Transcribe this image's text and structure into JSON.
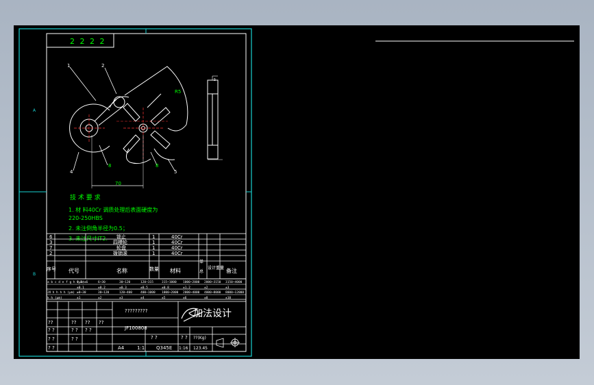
{
  "drawing": {
    "part_number_box": "2 2 2 2",
    "part_labels": [
      "1",
      "2",
      "3",
      "4",
      "5"
    ],
    "dimension_labels": {
      "radius": "R5",
      "distance": "70",
      "hole_label_left": "8",
      "hole_label_right": "8",
      "side_top": "5"
    },
    "tech_requirements": {
      "title": "技 术 要 求",
      "lines": [
        "1. 材 料40Cr 调质处理后表面硬度为",
        "220-250HBS",
        "2. 未注倒角半径为0.5；",
        "3. 未注尺寸IT2."
      ]
    }
  },
  "bom": {
    "rows": [
      {
        "no": "6",
        "name": "锁止",
        "qty": "1",
        "material": "40Cr"
      },
      {
        "no": "3",
        "name": "四槽轮",
        "qty": "1",
        "material": "40Cr"
      },
      {
        "no": "7",
        "name": "轮盘",
        "qty": "1",
        "material": "40Cr"
      },
      {
        "no": "2",
        "name": "拨销滚",
        "qty": "1",
        "material": "40Cr"
      }
    ],
    "header": {
      "no": "序号",
      "code": "代号",
      "name": "名称",
      "qty": "数量",
      "material": "材料",
      "single": "单",
      "weight": "设计重量",
      "total": "总",
      "remark": "备注"
    },
    "tolerance_rows": [
      {
        "label": "a b c d e f g h (μm)",
        "cells": [
          "0.5~±6",
          "6~30",
          "30~120",
          "120~315",
          "315~1000",
          "1000~2000",
          "2000~3150",
          "3150~4000"
        ]
      },
      {
        "label": "",
        "cells": [
          "±0.1",
          "±0.2",
          "±0.3",
          "±0.5",
          "±0.8",
          "±1.2",
          "±2",
          "±3"
        ]
      },
      {
        "label": "2Ⅱ h h h h (μm)",
        "cells": [
          "≥0~30",
          "30~120",
          "120~400",
          "400~1000",
          "1000~2000",
          "2000~4000",
          "4000~8000",
          "8000~12000"
        ]
      },
      {
        "label": "k h (μm)",
        "cells": [
          "±1",
          "±2",
          "±3",
          "±4",
          "±5",
          "±6",
          "±8",
          "±10"
        ]
      }
    ]
  },
  "title_block": {
    "drawing_name": "?????????",
    "drawing_code": "JF100808",
    "company": "加法设计",
    "scale_cells": [
      "? ?",
      "? ?"
    ],
    "weight_label": "??(Kg)",
    "weight_value": "123.45",
    "sheet_format": "A4",
    "scale_ratio": "1:1",
    "material": "Q345E",
    "page_ratio": "1:16",
    "sign_rows": [
      [
        "??",
        "??",
        "??",
        "??"
      ],
      [
        "? ?",
        "? ?",
        "? ?"
      ],
      [
        "? ?",
        "? ?"
      ],
      [
        "? ?"
      ]
    ]
  },
  "frame": {
    "zone_left_top": "A",
    "zone_left_bottom": "B"
  }
}
